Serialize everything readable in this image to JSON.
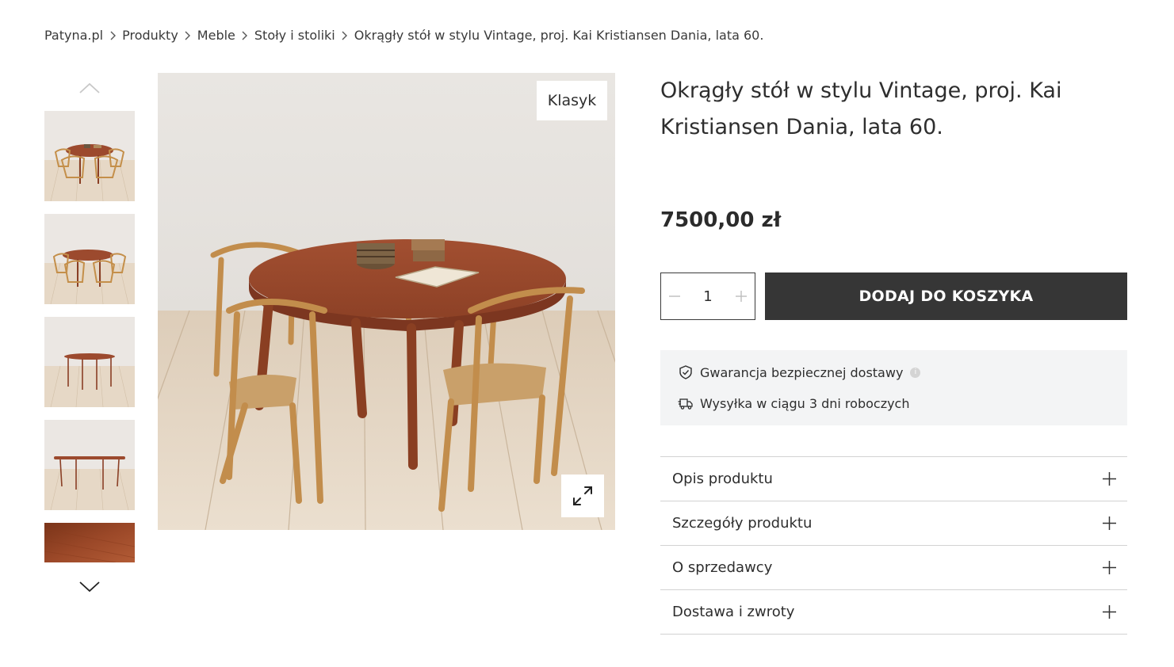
{
  "breadcrumb": {
    "items": [
      "Patyna.pl",
      "Produkty",
      "Meble",
      "Stoły i stoliki",
      "Okrągły stół w stylu Vintage, proj. Kai Kristiansen Dania, lata 60."
    ]
  },
  "gallery": {
    "up_icon": "chevron-up-icon",
    "down_icon": "chevron-down-icon",
    "thumbnails": [
      "table-with-chairs",
      "table-with-chairs-side",
      "table-alone",
      "table-side",
      "wood-detail"
    ],
    "main": {
      "tag": "Klasyk",
      "expand_icon": "expand-icon"
    }
  },
  "product": {
    "title": "Okrągły stół w stylu Vintage, proj. Kai Kristiansen Dania, lata 60.",
    "price": "7500,00 zł"
  },
  "cart": {
    "quantity": "1",
    "minus_icon": "minus-icon",
    "plus_icon": "plus-icon",
    "add_label": "DODAJ DO KOSZYKA"
  },
  "info": {
    "guarantee": "Gwarancja bezpiecznej dostawy",
    "info_mark": "i",
    "shipping": "Wysyłka w ciągu 3 dni roboczych"
  },
  "accordion": {
    "items": [
      {
        "label": "Opis produktu"
      },
      {
        "label": "Szczegóły produktu"
      },
      {
        "label": "O sprzedawcy"
      },
      {
        "label": "Dostawa i zwroty"
      }
    ]
  },
  "colors": {
    "button_bg": "#363636",
    "info_bg": "#f3f4f5",
    "teak": "#9c4a2e",
    "oak": "#c99752"
  }
}
